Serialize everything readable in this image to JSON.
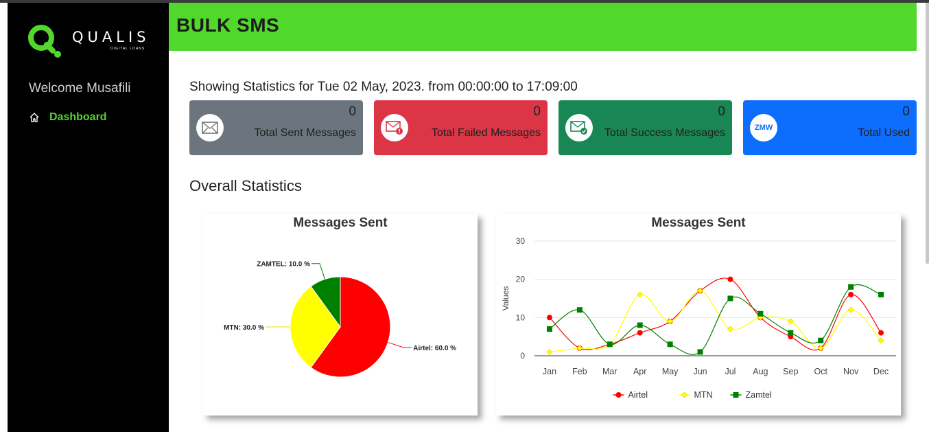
{
  "brand": {
    "name": "QUALIS",
    "tagline": "DIGITAL LOANS",
    "accent": "#52d82c"
  },
  "sidebar": {
    "welcome": "Welcome Musafili",
    "items": [
      {
        "label": "Dashboard",
        "icon": "home-icon"
      }
    ]
  },
  "header": {
    "title": "BULK SMS"
  },
  "stats_line": "Showing Statistics for Tue 02 May, 2023. from 00:00:00 to 17:09:00",
  "cards": [
    {
      "value": "0",
      "label": "Total Sent Messages",
      "color": "#6c757d",
      "icon": "envelope-icon"
    },
    {
      "value": "0",
      "label": "Total Failed Messages",
      "color": "#dc3545",
      "icon": "envelope-error-icon"
    },
    {
      "value": "0",
      "label": "Total Success Messages",
      "color": "#198754",
      "icon": "envelope-check-icon"
    },
    {
      "value": "0",
      "label": "Total Used",
      "color": "#0d6efd",
      "icon_text": "ZMW"
    }
  ],
  "overall_title": "Overall Statistics",
  "chart_data": [
    {
      "type": "pie",
      "title": "Messages Sent",
      "categories": [
        "Airtel",
        "MTN",
        "ZAMTEL"
      ],
      "values": [
        60.0,
        30.0,
        10.0
      ],
      "labels": [
        "Airtel: 60.0 %",
        "MTN: 30.0 %",
        "ZAMTEL: 10.0 %"
      ],
      "colors": [
        "#ff0000",
        "#ffff00",
        "#008000"
      ]
    },
    {
      "type": "line",
      "title": "Messages Sent",
      "ylabel": "Values",
      "xlabel": "",
      "ylim": [
        0,
        30
      ],
      "yticks": [
        0,
        10,
        20,
        30
      ],
      "categories": [
        "Jan",
        "Feb",
        "Mar",
        "Apr",
        "May",
        "Jun",
        "Jul",
        "Aug",
        "Sep",
        "Oct",
        "Nov",
        "Dec"
      ],
      "legend": "bottom",
      "grid": true,
      "series": [
        {
          "name": "Airtel",
          "color": "#ff0000",
          "marker": "circle",
          "values": [
            10,
            2,
            3,
            6,
            9,
            17,
            20,
            10,
            5,
            2,
            16,
            6
          ]
        },
        {
          "name": "MTN",
          "color": "#ffff00",
          "marker": "diamond",
          "values": [
            1,
            2,
            3,
            16,
            9,
            17,
            7,
            10,
            9,
            2,
            12,
            4
          ]
        },
        {
          "name": "Zamtel",
          "color": "#008000",
          "marker": "square",
          "values": [
            7,
            12,
            3,
            8,
            3,
            1,
            15,
            11,
            6,
            4,
            18,
            16
          ]
        }
      ]
    }
  ]
}
